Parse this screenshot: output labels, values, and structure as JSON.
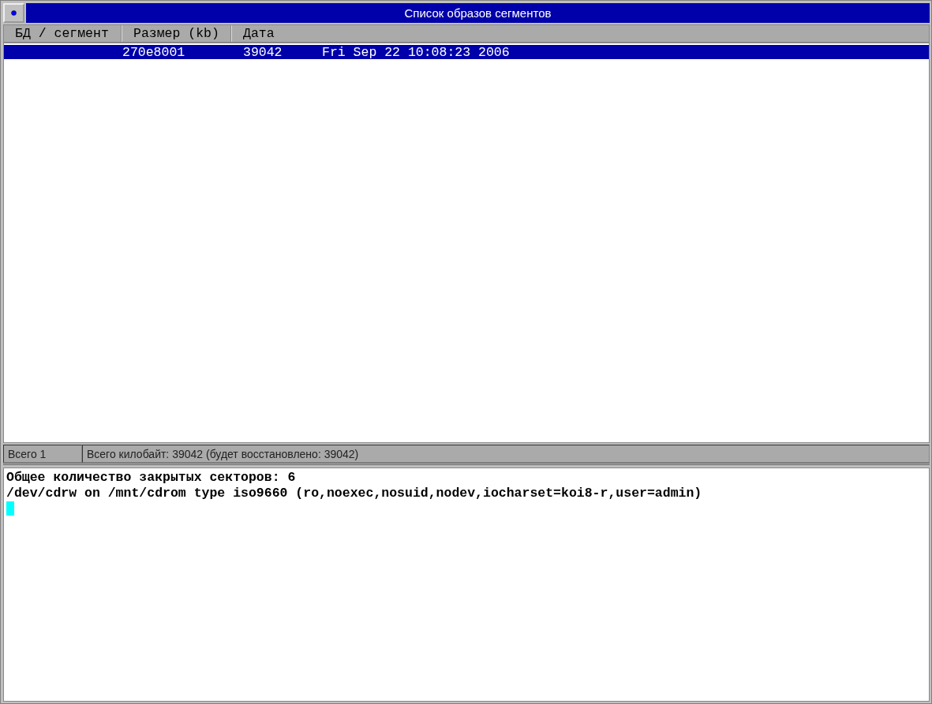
{
  "window": {
    "title": "Список образов сегментов"
  },
  "table": {
    "columns": [
      "БД / сегмент",
      "Размер (kb)",
      "Дата"
    ],
    "rows": [
      {
        "cells": [
          "",
          "270e8001",
          "39042",
          "Fri Sep 22 10:08:23 2006"
        ],
        "selected": true
      }
    ]
  },
  "status_bar": [
    "Всего 1",
    "Всего килобайт: 39042 (будет восстановлено: 39042)"
  ],
  "terminal": {
    "lines": [
      "Общее количество закрытых секторов: 6",
      "/dev/cdrw on /mnt/cdrom type iso9660 (ro,noexec,nosuid,nodev,iocharset=koi8-r,user=admin)"
    ]
  }
}
